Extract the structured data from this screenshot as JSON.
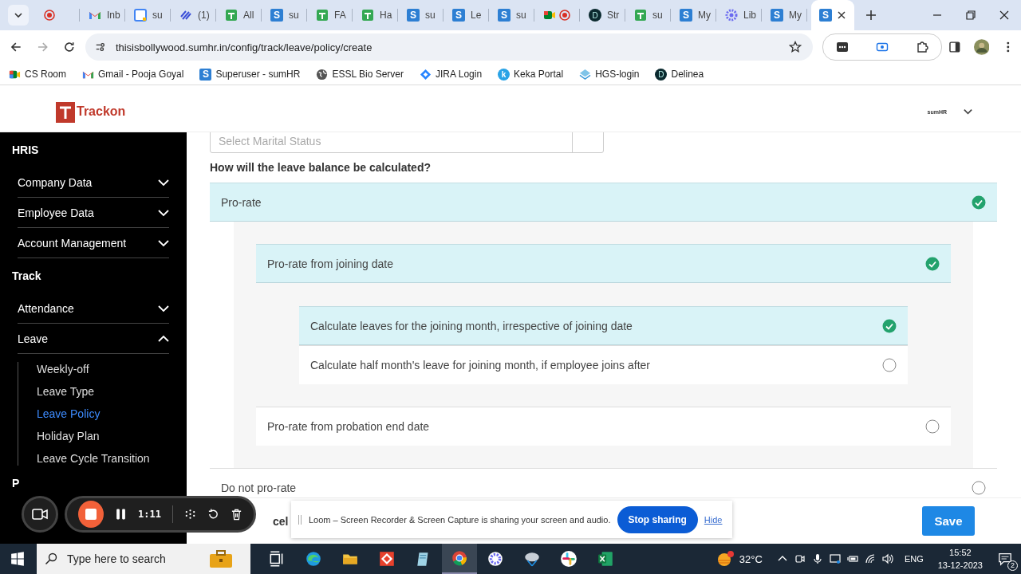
{
  "browser": {
    "tabs": [
      {
        "kind": "record",
        "selected": false
      },
      {
        "kind": "gmail",
        "label": "Inb",
        "selected": false
      },
      {
        "kind": "calendar",
        "label": "su",
        "selected": false
      },
      {
        "kind": "linear",
        "label": "(1)",
        "selected": false
      },
      {
        "kind": "sheets",
        "label": "All",
        "selected": false
      },
      {
        "kind": "letter",
        "letter": "S",
        "label": "su",
        "selected": false
      },
      {
        "kind": "sheets",
        "label": "FA",
        "selected": false
      },
      {
        "kind": "sheets",
        "label": "Ha",
        "selected": false
      },
      {
        "kind": "letter",
        "letter": "S",
        "label": "su",
        "selected": false
      },
      {
        "kind": "letter",
        "letter": "S",
        "label": "Le",
        "selected": false
      },
      {
        "kind": "letter",
        "letter": "S",
        "label": "su",
        "selected": false
      },
      {
        "kind": "meet",
        "selected": false
      },
      {
        "kind": "dark",
        "letter": "D",
        "label": "Str",
        "selected": false
      },
      {
        "kind": "sheets",
        "label": "su",
        "selected": false
      },
      {
        "kind": "letter",
        "letter": "S",
        "label": "My",
        "selected": false
      },
      {
        "kind": "gear",
        "label": "Lib",
        "selected": false
      },
      {
        "kind": "letter",
        "letter": "S",
        "label": "My",
        "selected": false
      },
      {
        "kind": "letter",
        "letter": "S",
        "selected": true
      }
    ],
    "url": "thisisbollywood.sumhr.in/config/track/leave/policy/create",
    "bookmarks": [
      {
        "kind": "meet",
        "label": "CS Room"
      },
      {
        "kind": "gmail",
        "label": "Gmail - Pooja Goyal"
      },
      {
        "kind": "letter",
        "letter": "S",
        "label": "Superuser - sumHR"
      },
      {
        "kind": "globe",
        "label": "ESSL Bio Server"
      },
      {
        "kind": "jira",
        "label": "JIRA Login"
      },
      {
        "kind": "circle",
        "letter": "k",
        "label": "Keka Portal"
      },
      {
        "kind": "stack",
        "label": "HGS-login"
      },
      {
        "kind": "dark",
        "letter": "D",
        "label": "Delinea"
      }
    ]
  },
  "header": {
    "logo": "Trackon",
    "account": "sumHR"
  },
  "sidebar": [
    {
      "title": "HRIS",
      "items": [
        {
          "label": "Company Data",
          "expanded": false
        },
        {
          "label": "Employee Data",
          "expanded": false
        },
        {
          "label": "Account Management",
          "expanded": false
        }
      ]
    },
    {
      "title": "Track",
      "items": [
        {
          "label": "Attendance",
          "expanded": false
        },
        {
          "label": "Leave",
          "expanded": true,
          "children": [
            {
              "label": "Weekly-off",
              "selected": false
            },
            {
              "label": "Leave Type",
              "selected": false
            },
            {
              "label": "Leave Policy",
              "selected": true
            },
            {
              "label": "Holiday Plan",
              "selected": false
            },
            {
              "label": "Leave Cycle Transition",
              "selected": false
            }
          ]
        }
      ]
    },
    {
      "title": "P"
    }
  ],
  "form": {
    "field": {
      "placeholder": "Select Marital Status"
    },
    "question": "How will the leave balance be calculated?",
    "options": [
      {
        "label": "Pro-rate",
        "selected": true,
        "children": [
          {
            "label": "Pro-rate from joining date",
            "selected": true,
            "children": [
              {
                "label": "Calculate leaves for the joining month, irrespective of joining date",
                "selected": true
              },
              {
                "label": "Calculate half month's leave for joining month, if employee joins after",
                "selected": false
              }
            ]
          },
          {
            "label": "Pro-rate from probation end date",
            "selected": false
          }
        ]
      },
      {
        "label": "Do not pro-rate",
        "selected": false
      }
    ],
    "cancel": "cel",
    "save": "Save"
  },
  "recorder": {
    "time": "1:11"
  },
  "loom_notice": {
    "message": "Loom – Screen Recorder & Screen Capture is sharing your screen and audio.",
    "stop": "Stop sharing",
    "hide": "Hide"
  },
  "taskbar": {
    "search": "Type here to search",
    "temperature": "32°C",
    "language": "ENG",
    "time": "15:52",
    "date": "13-12-2023",
    "notifications": "2"
  }
}
